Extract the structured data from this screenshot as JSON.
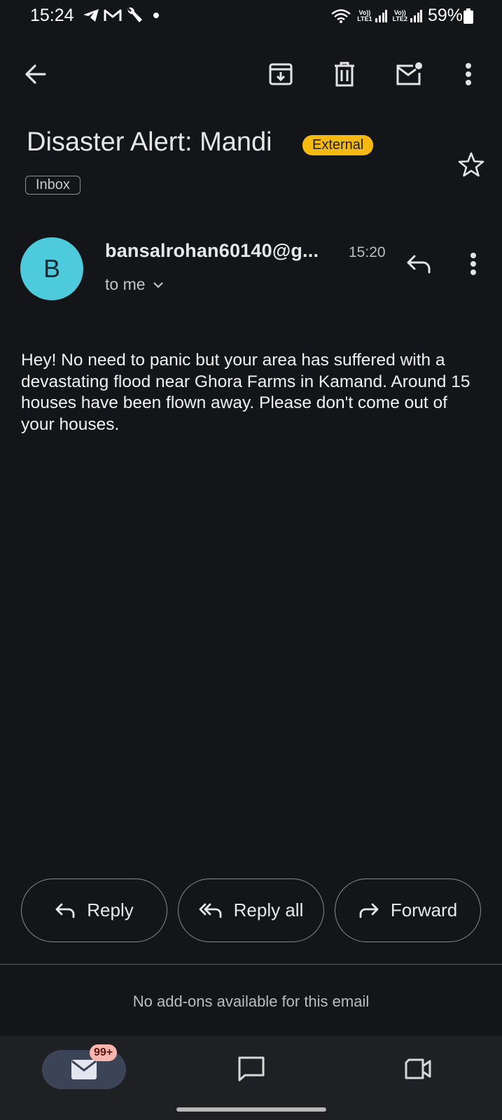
{
  "status_bar": {
    "time": "15:24",
    "battery_percent": "59%",
    "sim1_label_top": "Vo))",
    "sim1_label_bottom": "LTE1",
    "sim2_label_top": "Vo))",
    "sim2_label_bottom": "LTE2",
    "notification_icons": [
      "telegram-icon",
      "gmail-icon",
      "wrench-icon",
      "dot-icon"
    ]
  },
  "toolbar": {
    "icons": [
      "back-arrow-icon",
      "archive-icon",
      "delete-icon",
      "mark-unread-icon",
      "more-vert-icon"
    ]
  },
  "email": {
    "subject": "Disaster Alert: Mandi",
    "external_label": "External",
    "folder_label": "Inbox",
    "sender_initial": "B",
    "sender": "bansalrohan60140@g...",
    "time": "15:20",
    "recipient": "to me",
    "body": "Hey! No need to panic but your area has suffered with a devastating flood near Ghora Farms in Kamand. Around 15 houses have been flown away. Please don't come out of your houses."
  },
  "actions": {
    "reply": "Reply",
    "reply_all": "Reply all",
    "forward": "Forward"
  },
  "addons_text": "No add-ons available for this email",
  "bottom_nav": {
    "mail_badge": "99+",
    "items": [
      "mail-icon",
      "chat-icon",
      "meet-icon"
    ]
  },
  "colors": {
    "background": "#141519",
    "avatar": "#4dcadb",
    "external_badge": "#f6b911",
    "nav_active": "#3b4457",
    "badge": "#f8b7ae"
  }
}
